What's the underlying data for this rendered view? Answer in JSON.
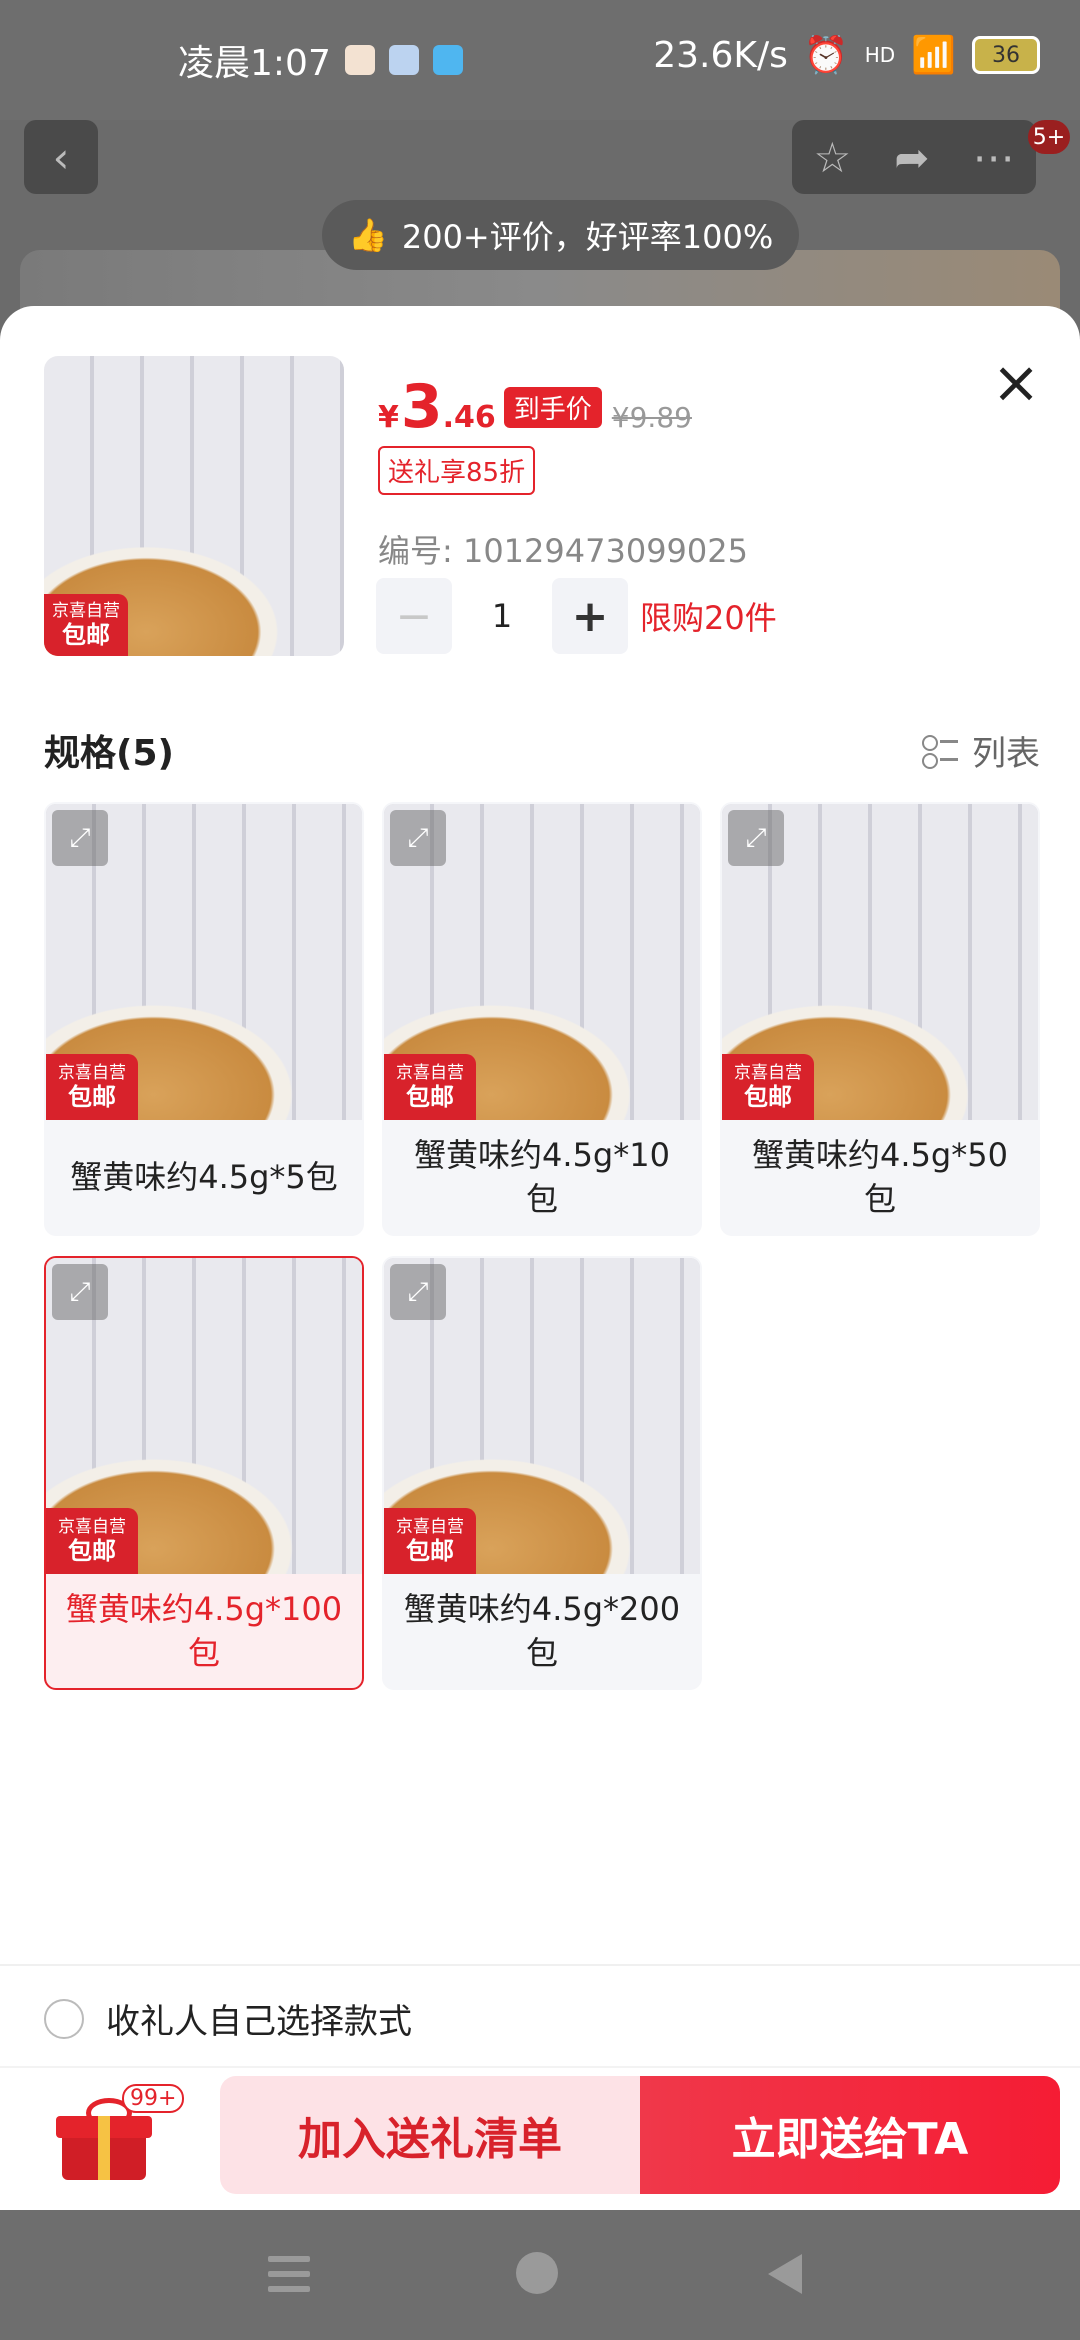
{
  "status_bar": {
    "time": "凌晨1:07",
    "net_speed": "23.6K/s",
    "signal": "HD",
    "battery": "36"
  },
  "header": {
    "back_icon": "back-arrow-icon",
    "cart_badge": "5+",
    "review_summary": "200+评价，好评率100%"
  },
  "sheet": {
    "price_currency": "¥",
    "price_int": "3",
    "price_dec": ".46",
    "handprice_label": "到手价",
    "original_price": "¥9.89",
    "gift_discount": "送礼享85折",
    "sku_number": "编号: 10129473099025",
    "quantity": "1",
    "purchase_limit": "限购20件",
    "badge_line1": "京喜自营",
    "badge_line2": "包邮",
    "spec_title": "规格(5)",
    "list_toggle": "列表",
    "specs": [
      {
        "label": "蟹黄味约4.5g*5包",
        "selected": false
      },
      {
        "label": "蟹黄味约4.5g*10包",
        "selected": false
      },
      {
        "label": "蟹黄味约4.5g*50包",
        "selected": false
      },
      {
        "label": "蟹黄味约4.5g*100包",
        "selected": true
      },
      {
        "label": "蟹黄味约4.5g*200包",
        "selected": false
      }
    ],
    "recipient_choice": "收礼人自己选择款式"
  },
  "footer": {
    "gift_count": "99+",
    "add_button": "加入送礼清单",
    "send_button": "立即送给TA"
  },
  "colors": {
    "accent": "#e4232b",
    "selected_bg": "#fdeef0"
  }
}
